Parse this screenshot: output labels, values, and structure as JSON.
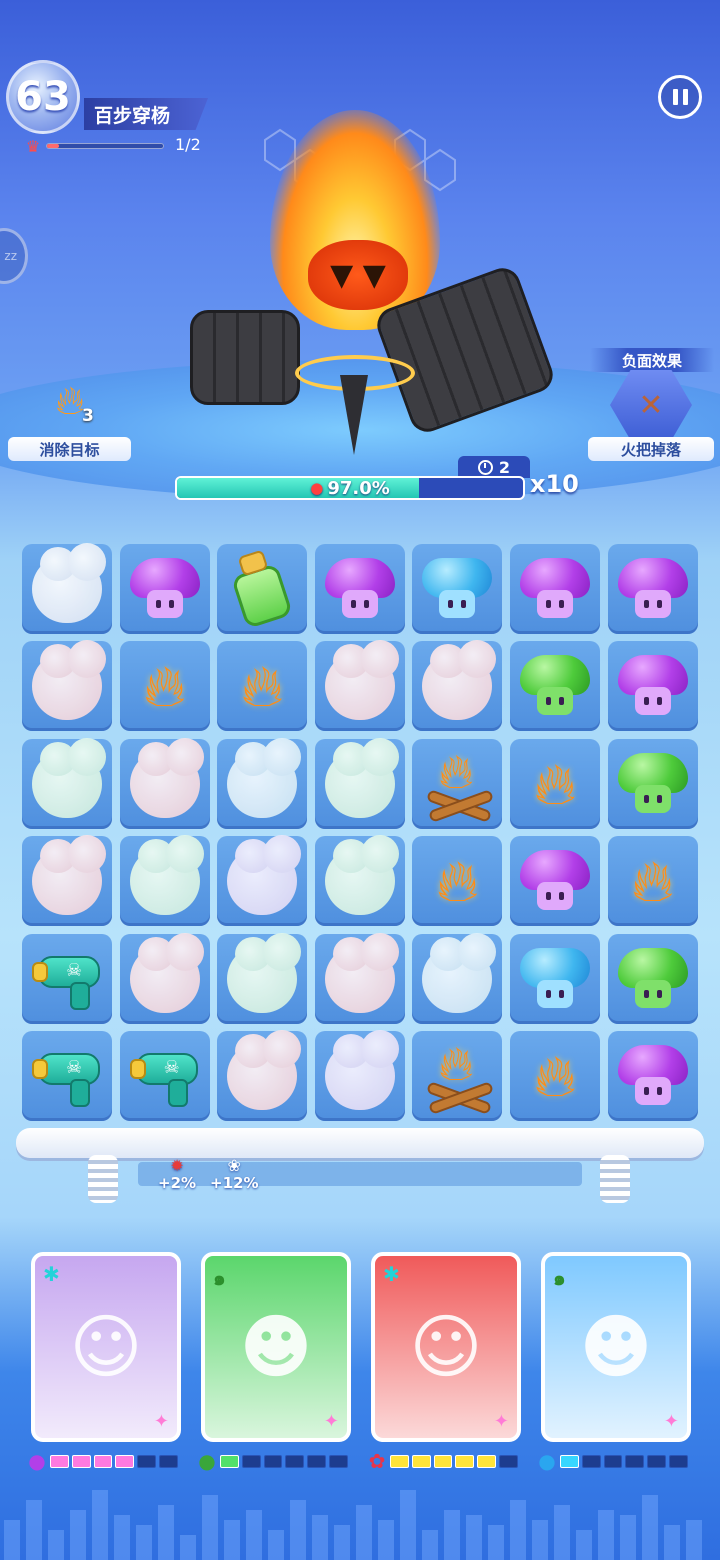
{
  "level": {
    "number": "63",
    "title": "百步穿杨",
    "progress_text": "1/2",
    "progress_fraction": 0.1
  },
  "target": {
    "count": "3",
    "label": "消除目标"
  },
  "negative_effect": {
    "header": "负面效果",
    "label": "火把掉落"
  },
  "boss": {
    "turns": "2",
    "hp_percent_text": "97.0%",
    "hp_fraction": 0.7,
    "multiplier": "x10"
  },
  "board": {
    "rows": [
      [
        "cloud-white",
        "mushroom-purple",
        "potion",
        "mushroom-purple",
        "mushroom-blue",
        "mushroom-purple",
        "mushroom-purple"
      ],
      [
        "cloud-pink",
        "flame",
        "flame",
        "cloud-pink",
        "cloud-pink",
        "mushroom-green",
        "mushroom-purple"
      ],
      [
        "cloud-mint",
        "cloud-pink",
        "cloud-ice",
        "cloud-mint",
        "campfire",
        "flame",
        "mushroom-green"
      ],
      [
        "cloud-pink",
        "cloud-mint",
        "cloud-lav",
        "cloud-mint",
        "flame",
        "mushroom-purple",
        "flame"
      ],
      [
        "water-gun",
        "cloud-pink",
        "cloud-mint",
        "cloud-pink",
        "cloud-ice",
        "mushroom-blue",
        "mushroom-green"
      ],
      [
        "water-gun",
        "water-gun",
        "cloud-pink",
        "cloud-lav",
        "campfire",
        "flame",
        "mushroom-purple"
      ]
    ]
  },
  "buffs": [
    {
      "icon": "firecracker-icon",
      "text": "+2%"
    },
    {
      "icon": "rabbit-icon",
      "text": "+12%"
    }
  ],
  "heroes": [
    {
      "name": "hero-headphone-girl",
      "bg": "#c6a7f0",
      "type_icon": "✱",
      "type_color": "#22d3d9",
      "energy_color": "#ff7ae0",
      "energy_filled": 4,
      "energy_icon": "mushroom-purple-icon"
    },
    {
      "name": "hero-maid-girl",
      "bg": "#5bd66c",
      "type_icon": "๑",
      "type_color": "#2c8f2c",
      "energy_color": "#52e06a",
      "energy_filled": 1,
      "energy_icon": "mushroom-green-icon"
    },
    {
      "name": "hero-cat-gentleman",
      "bg": "#f05a5a",
      "type_icon": "✱",
      "type_color": "#22d3d9",
      "energy_color": "#ffe43a",
      "energy_filled": 5,
      "energy_icon": "flower-red-icon"
    },
    {
      "name": "hero-opera-general",
      "bg": "#7fc9ff",
      "type_icon": "๑",
      "type_color": "#2c8f2c",
      "energy_color": "#37d7ff",
      "energy_filled": 1,
      "energy_icon": "mushroom-blue-icon"
    }
  ]
}
